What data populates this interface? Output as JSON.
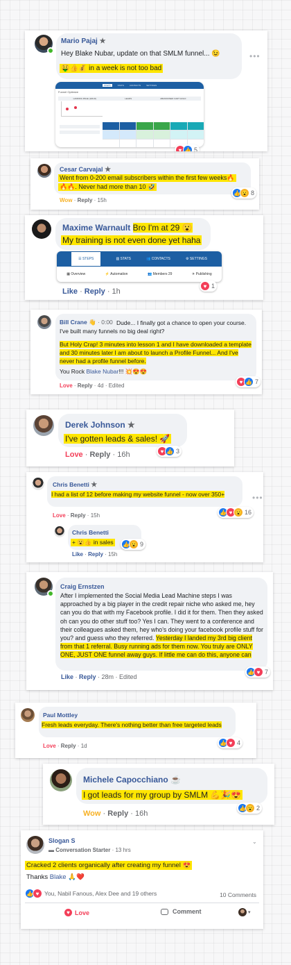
{
  "c1": {
    "name": "Mario Pajaj",
    "text": "Hey Blake Nubar, update on that SMLM funnel... 😉",
    "highlight": "🤑👍💰 in a week is not too bad",
    "shot_tabs": [
      "STEPS",
      "STATS",
      "CONTACTS",
      "SETTINGS"
    ],
    "shot_title": "Funnel Optimize",
    "shot_cols": [
      "LANDING PAGE (HOLD)",
      "LEADS",
      "ABANDONED CART HOLD"
    ],
    "shot_count": "5"
  },
  "c2": {
    "name": "Cesar Carvajal",
    "line1": "Went from 0-200 email subscribers within the first few weeks🔥",
    "line2": "🔥🔥. Never had more than 10 🤣",
    "action_react": "Wow",
    "action_reply": "Reply",
    "time": "15h",
    "count": "8"
  },
  "c3": {
    "name": "Maxime Warnault",
    "text1": "Bro I'm at 29 😮",
    "text2": "My training is not even done yet haha",
    "tabs": [
      "STEPS",
      "STATS",
      "CONTACTS",
      "SETTINGS"
    ],
    "subtabs": [
      "Overview",
      "Automation",
      "Members 29",
      "Publishing"
    ],
    "action_like": "Like",
    "action_reply": "Reply",
    "time": "1h",
    "count": "1"
  },
  "c4": {
    "name": "Bill Crane",
    "audio_time": "0:00",
    "p1": "Dude... I finally got a chance to open your course. I've built many funnels no big deal right?",
    "p2": "But Holy Crap! 3 minutes into lesson 1 and I have downloaded a template and 30 minutes later I am about to launch a Profile Funnel... And I've never had a profile funnel before.",
    "p3_prefix": "You Rock",
    "p3_mention": "Blake Nubar",
    "p3_suffix": "!!! 💥😍😍",
    "action_react": "Love",
    "action_reply": "Reply",
    "time": "4d",
    "edited": "Edited",
    "count": "7"
  },
  "c5": {
    "name": "Derek Johnson",
    "text": "I've gotten leads & sales! 🚀",
    "action_react": "Love",
    "action_reply": "Reply",
    "time": "16h",
    "count": "3"
  },
  "c6": {
    "name": "Chris Benetti",
    "text": "I had a list of 12 before making my website funnel - now over 350+",
    "action_react": "Love",
    "action_reply": "Reply",
    "time": "15h",
    "count": "16",
    "reply_name": "Chris Benetti",
    "reply_text": "+ 😮👍 in sales",
    "reply_like": "Like",
    "reply_reply": "Reply",
    "reply_time": "15h",
    "reply_count": "9"
  },
  "c7": {
    "name": "Craig Ernstzen",
    "plain": "After I implemented the Social Media Lead Machine steps I was approached by a big player in the credit repair niche who asked me, hey can you do that with my Facebook profile. I did it for them. Then they asked oh can you do other stuff too? Yes I can. They went to a conference and their colleagues asked them, hey who's doing your facebook profile stuff for you? and guess who they referred.",
    "highlight": "Yesterday I landed my 3rd big client from that 1 referral. Busy running ads for them now. You truly are ONLY ONE, JUST ONE funnel away guys. If little me can do this, anyone can",
    "action_like": "Like",
    "action_reply": "Reply",
    "time": "28m",
    "edited": "Edited",
    "count": "7"
  },
  "c8": {
    "name": "Paul Mottley",
    "text": "Fresh leads everyday. There's nothing better than free targeted leads",
    "action_react": "Love",
    "action_reply": "Reply",
    "time": "1d",
    "count": "4"
  },
  "c9": {
    "name": "Michele Capocchiano",
    "text": "I got leads for my group by SMLM 💪🎉😍",
    "action_react": "Wow",
    "action_reply": "Reply",
    "time": "16h",
    "count": "2"
  },
  "c10": {
    "name": "Slogan S",
    "badge": "Conversation Starter",
    "time": "13 hrs",
    "highlight": "Cracked 2 clients organically after creating my funnel 😍",
    "thanks": "Thanks",
    "mention": "Blake",
    "emoji": "🙏❤️",
    "reactors": "You, Nabil Fanous, Alex Dee and 19 others",
    "comments": "10 Comments",
    "btn_love": "Love",
    "btn_comment": "Comment"
  },
  "colors": {
    "highlight": "#ffe600",
    "link": "#385898",
    "love": "#f33e58",
    "wow": "#f7b125",
    "like_blue": "#1877f2"
  }
}
